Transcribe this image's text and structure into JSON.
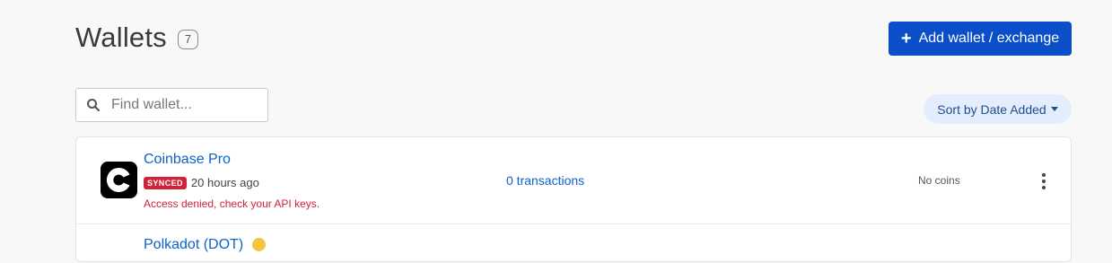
{
  "header": {
    "title": "Wallets",
    "count": "7",
    "add_button_label": "Add wallet / exchange"
  },
  "search": {
    "placeholder": "Find wallet..."
  },
  "sort": {
    "label": "Sort by Date Added"
  },
  "wallets": [
    {
      "name": "Coinbase Pro",
      "status": "SYNCED",
      "synced_ago": "20 hours ago",
      "error": "Access denied, check your API keys.",
      "transactions": "0 transactions",
      "coins": "No coins"
    },
    {
      "name": "Polkadot (DOT)"
    }
  ],
  "colors": {
    "primary": "#0b4fc8",
    "link": "#0b62c8",
    "danger": "#d0233a",
    "sort_bg": "#e3edfb"
  }
}
